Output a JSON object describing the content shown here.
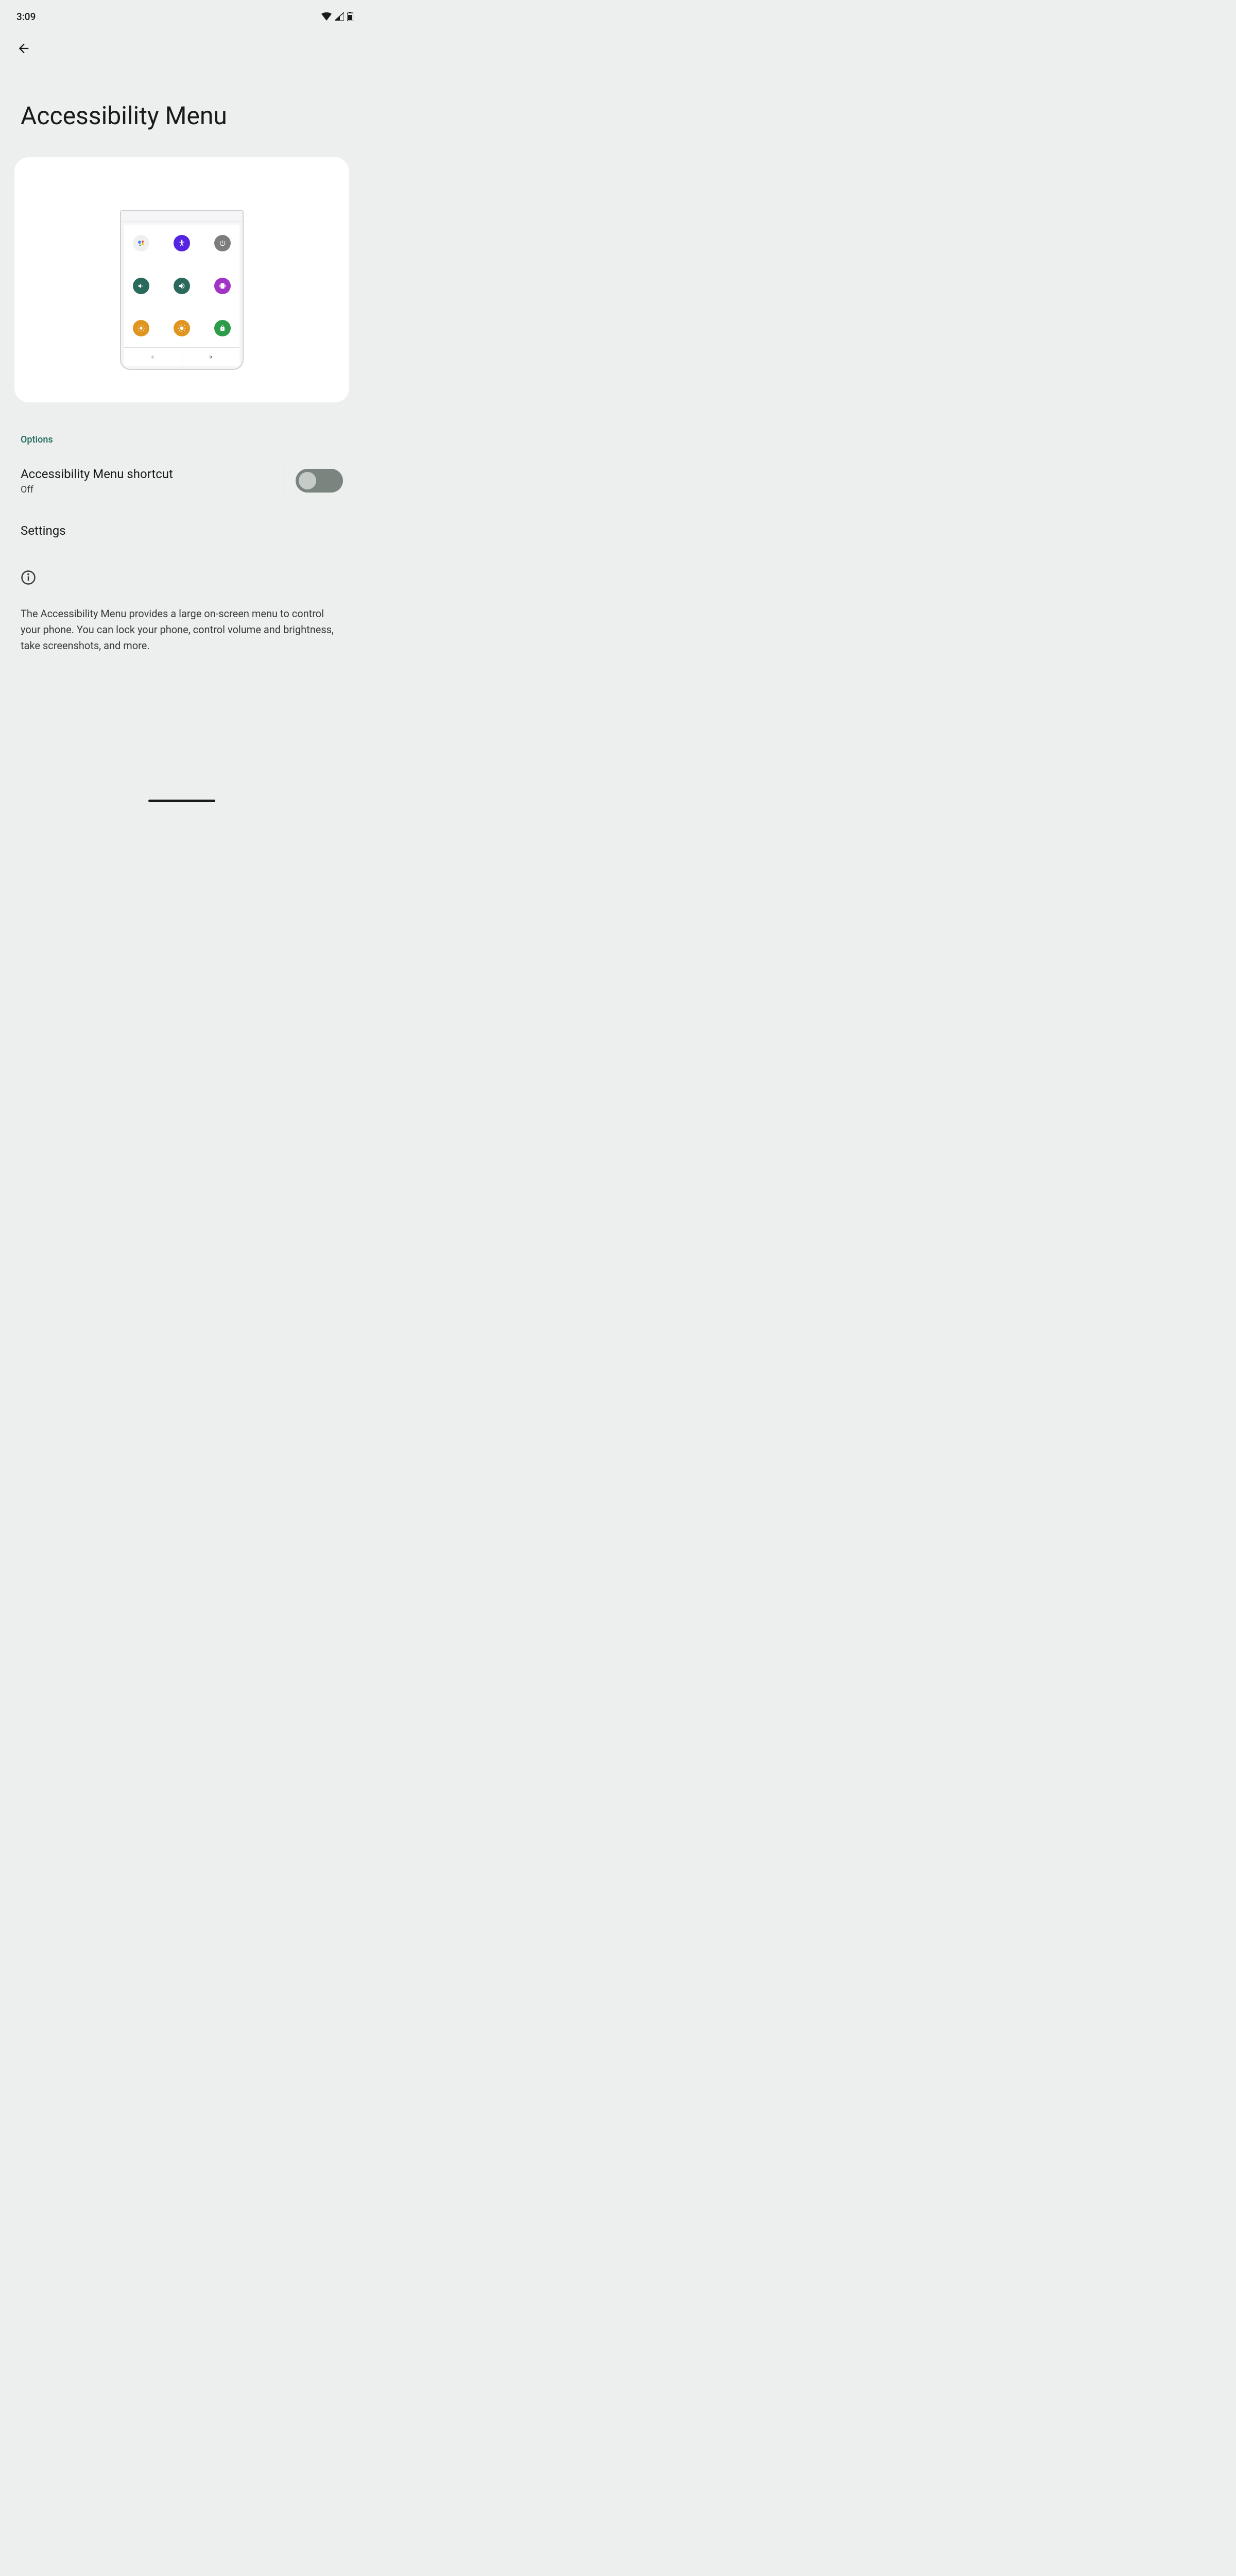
{
  "statusBar": {
    "time": "3:09"
  },
  "pageTitle": "Accessibility Menu",
  "sectionLabel": "Options",
  "shortcut": {
    "title": "Accessibility Menu shortcut",
    "status": "Off",
    "enabled": false
  },
  "settingsRow": {
    "title": "Settings"
  },
  "info": {
    "text": "The Accessibility Menu provides a large on-screen menu to control your phone. You can lock your phone, control volume and brightness, take screenshots, and more."
  },
  "previewIcons": [
    "assistant",
    "accessibility",
    "power",
    "volume-down",
    "volume-up",
    "vibrate",
    "brightness-down",
    "brightness-up",
    "lock"
  ]
}
